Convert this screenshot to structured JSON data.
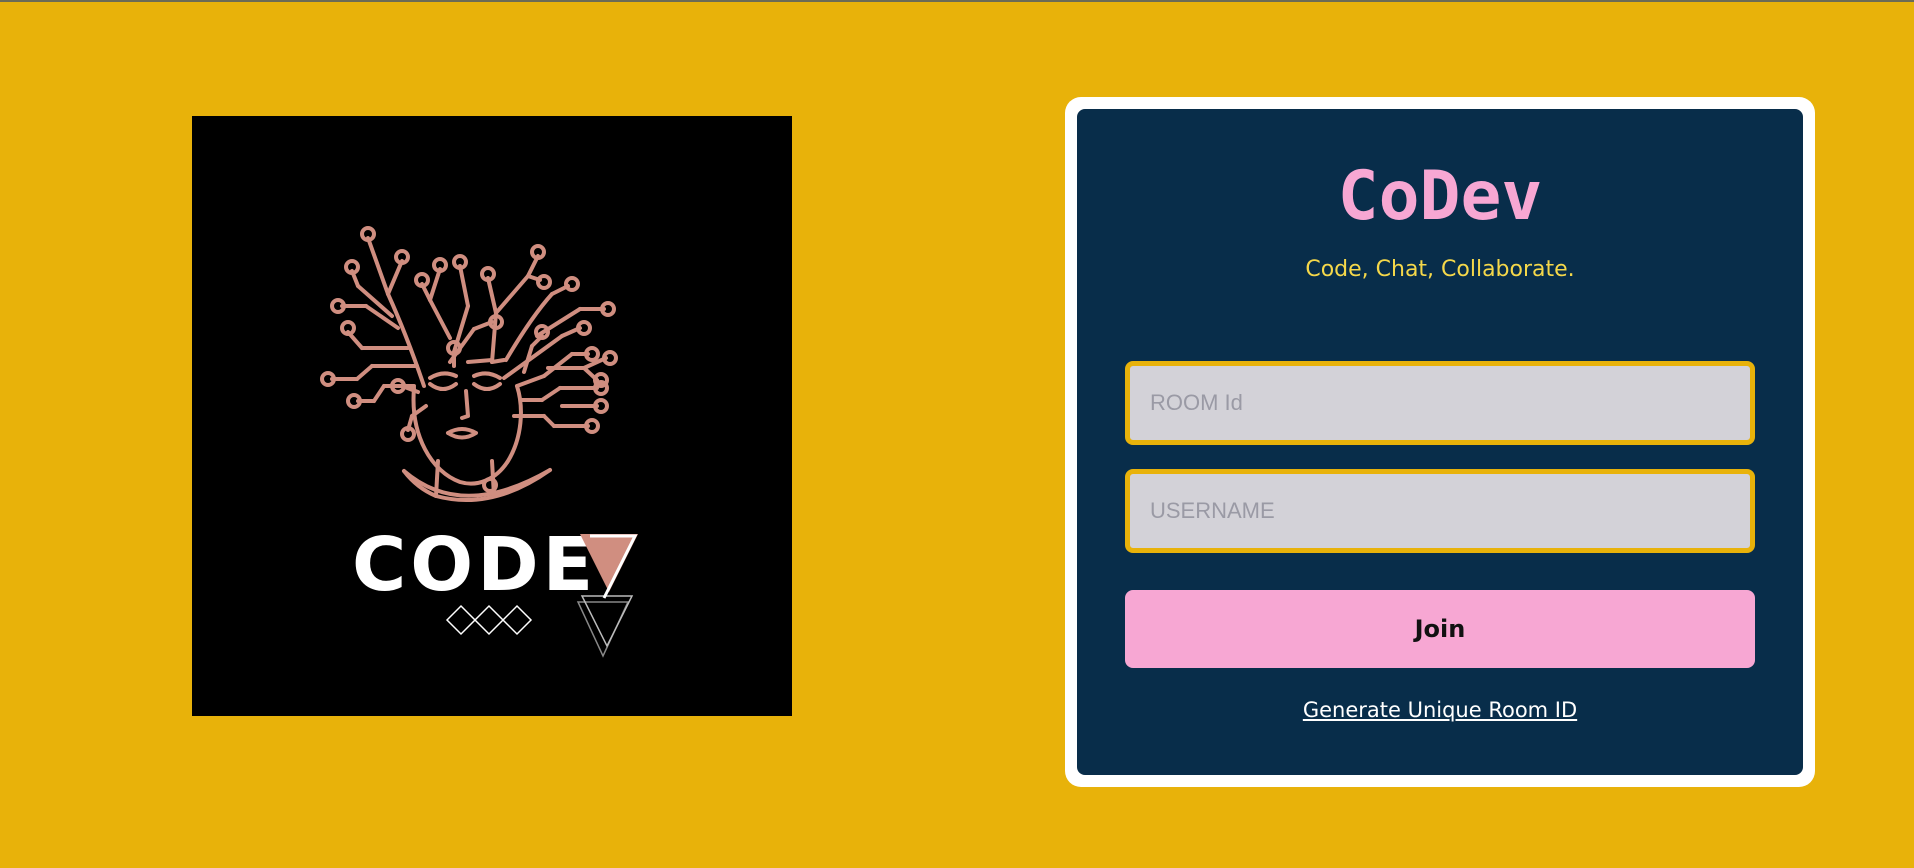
{
  "brand": {
    "title": "CoDev",
    "tagline": "Code, Chat, Collaborate.",
    "logo_text": "CODEV"
  },
  "form": {
    "room_id": {
      "placeholder": "ROOM Id",
      "value": ""
    },
    "username": {
      "placeholder": "USERNAME",
      "value": ""
    },
    "join_label": "Join",
    "generate_link_label": "Generate Unique Room ID"
  },
  "colors": {
    "page_background": "#E8B20A",
    "card_background": "#082D4A",
    "title": "#F7A7D3",
    "tagline": "#F5D84A",
    "button": "#F7A7D3",
    "input_background": "#D3D2D8",
    "logo_stroke": "#D08E80"
  }
}
